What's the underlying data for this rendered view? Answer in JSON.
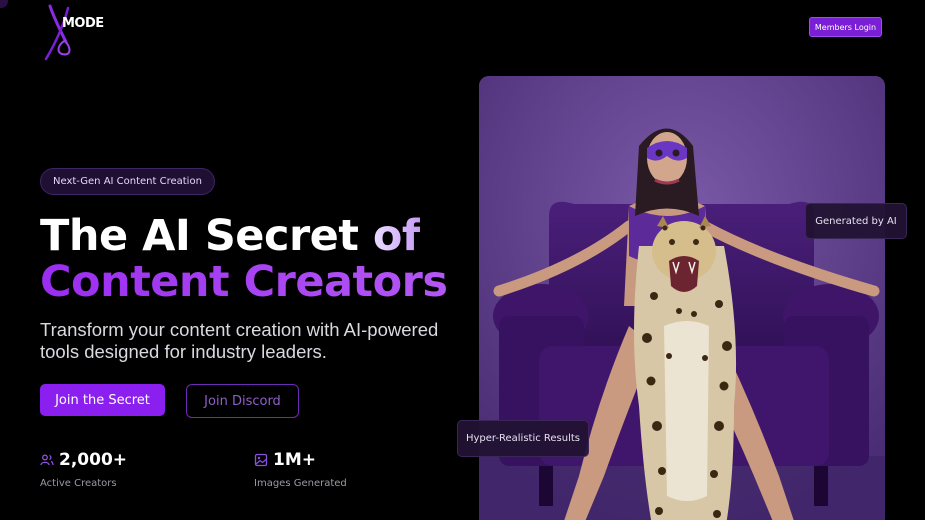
{
  "header": {
    "logo_text": "MODE",
    "members_login": "Members Login"
  },
  "hero": {
    "badge": "Next-Gen AI Content Creation",
    "title_part1": "The AI Secret ",
    "title_part2": "of",
    "title_line2": "Content Creators",
    "subtitle": "Transform your content creation with AI-powered tools designed for industry leaders.",
    "primary_cta": "Join the Secret",
    "secondary_cta": "Join Discord"
  },
  "stats": [
    {
      "icon": "users-icon",
      "value": "2,000+",
      "label": "Active Creators"
    },
    {
      "icon": "image-icon",
      "value": "1M+",
      "label": "Images Generated"
    }
  ],
  "image_card": {
    "tag_top": "Generated by AI",
    "tag_bottom": "Hyper-Realistic Results"
  },
  "colors": {
    "accent": "#8a1ff0",
    "background": "#000000",
    "card_purple": "#5b3b86"
  }
}
